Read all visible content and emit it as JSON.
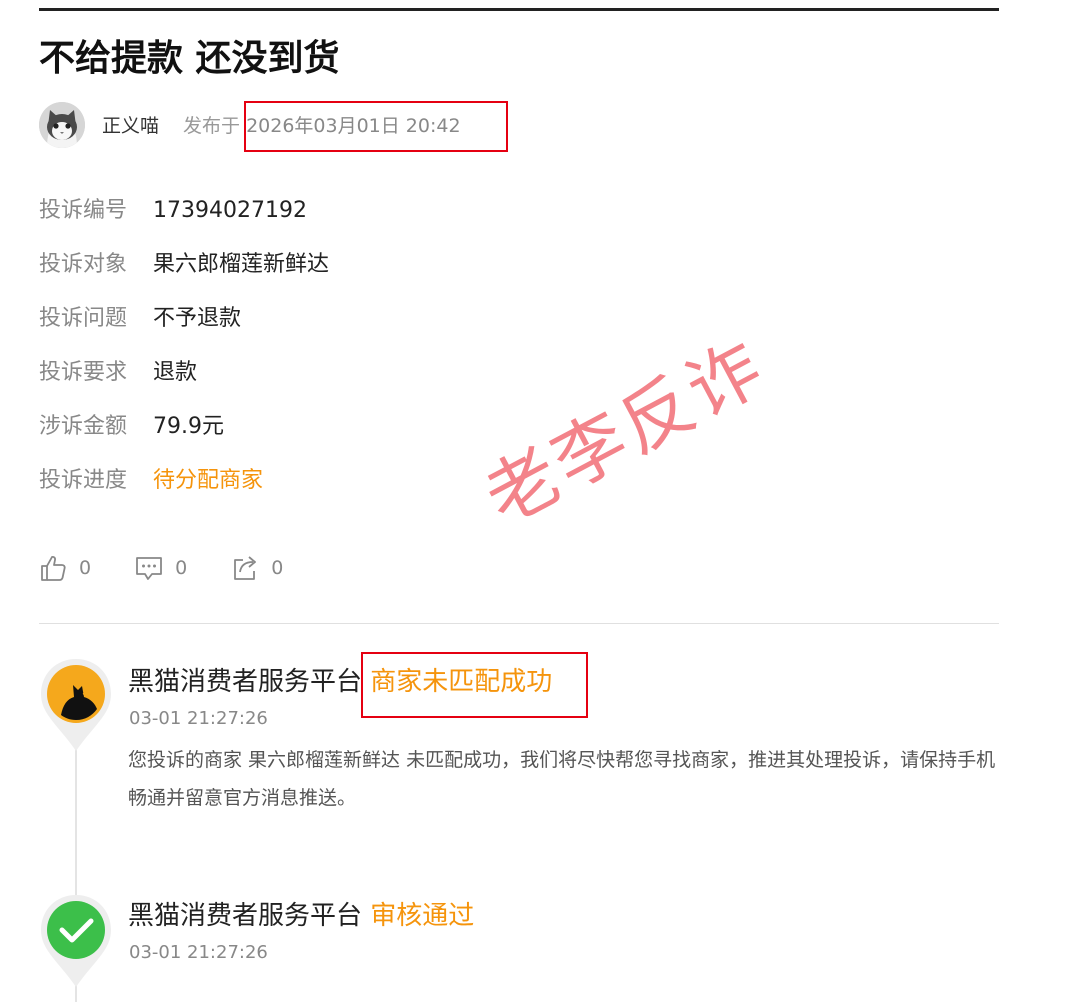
{
  "post": {
    "title": "不给提款 还没到货",
    "author": "正义喵",
    "posted_prefix": "发布于",
    "posted_date": "2026年03月01日 20:42"
  },
  "complaint": {
    "rows": [
      {
        "label": "投诉编号",
        "value": "17394027192"
      },
      {
        "label": "投诉对象",
        "value": "果六郎榴莲新鲜达"
      },
      {
        "label": "投诉问题",
        "value": "不予退款"
      },
      {
        "label": "投诉要求",
        "value": "退款"
      },
      {
        "label": "涉诉金额",
        "value": "79.9元"
      },
      {
        "label": "投诉进度",
        "value": "待分配商家",
        "accent": "#f5940c"
      }
    ]
  },
  "actions": {
    "like": {
      "icon": "thumbs-up-icon",
      "count": "0"
    },
    "comment": {
      "icon": "comment-icon",
      "count": "0"
    },
    "share": {
      "icon": "share-icon",
      "count": "0"
    }
  },
  "timeline": [
    {
      "icon": "black-cat-logo-icon",
      "source": "黑猫消费者服务平台",
      "status": "商家未匹配成功",
      "time": "03-01 21:27:26",
      "desc": "您投诉的商家 果六郎榴莲新鲜达 未匹配成功，我们将尽快帮您寻找商家，推进其处理投诉，请保持手机畅通并留意官方消息推送。"
    },
    {
      "icon": "green-check-icon",
      "source": "黑猫消费者服务平台",
      "status": "审核通过",
      "time": "03-01 21:27:26"
    }
  ],
  "watermark": "老李反诈",
  "colors": {
    "accent_orange": "#f5940c",
    "highlight_red": "#e50011",
    "watermark": "#ef5a64",
    "check_green": "#3cbf4a"
  }
}
